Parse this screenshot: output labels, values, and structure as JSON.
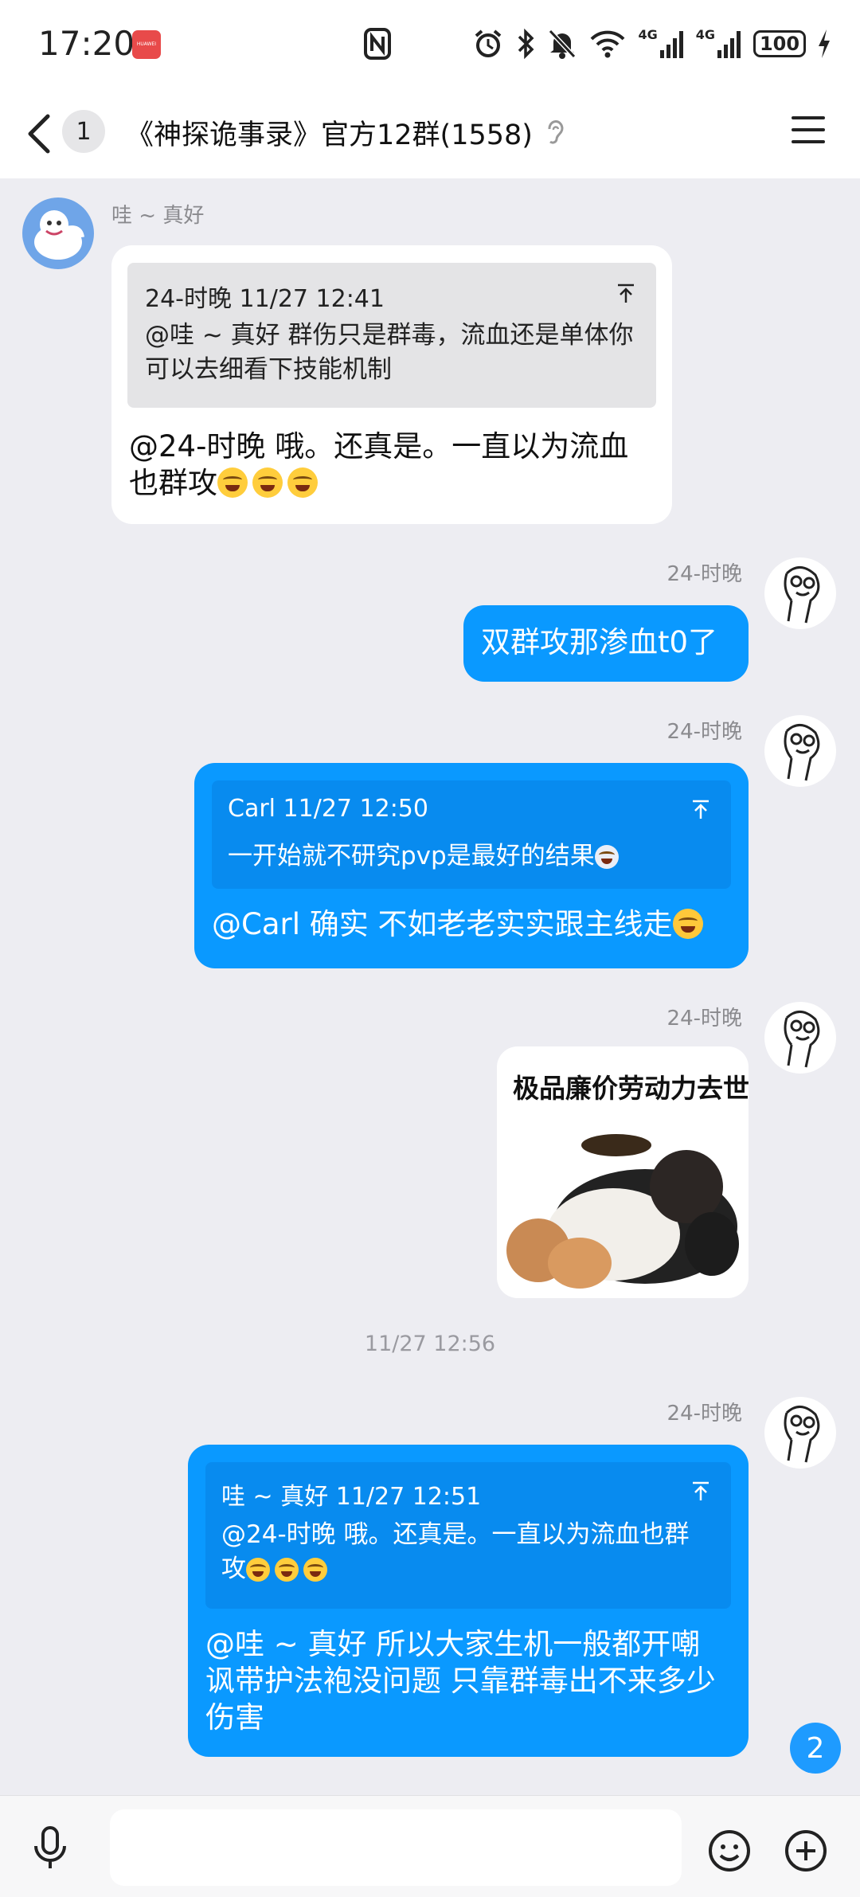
{
  "status": {
    "time": "17:20",
    "carrier_badge": "HUAWEI",
    "signal1": "4G",
    "signal2": "4G",
    "battery": "100"
  },
  "header": {
    "unread_count": "1",
    "title": "《神探诡事录》官方12群(1558)"
  },
  "messages": [
    {
      "sender": "哇 ~ 真好",
      "quote_head": "24-时晚 11/27 12:41",
      "quote_body": "@哇 ~ 真好 群伤只是群毒，流血还是单体你可以去细看下技能机制",
      "text": "@24-时晚 哦。还真是。一直以为流血也群攻"
    },
    {
      "sender": "24-时晚",
      "text": "双群攻那渗血t0了"
    },
    {
      "sender": "24-时晚",
      "quote_head": "Carl 11/27 12:50",
      "quote_body": "一开始就不研究pvp是最好的结果",
      "text": "@Carl 确实 不如老老实实跟主线走"
    },
    {
      "sender": "24-时晚",
      "sticker_caption": "极品廉价劳动力去世"
    },
    {
      "divider": "11/27 12:56"
    },
    {
      "sender": "24-时晚",
      "quote_head": "哇 ~ 真好 11/27 12:51",
      "quote_body": "@24-时晚 哦。还真是。一直以为流血也群攻",
      "text": "@哇 ~ 真好 所以大家生机一般都开嘲讽带护法袍没问题 只靠群毒出不来多少伤害"
    }
  ],
  "new_message_badge": "2",
  "input": {
    "placeholder": ""
  },
  "icons": [
    "back-arrow-icon",
    "ear-icon",
    "menu-icon",
    "jump-to-quote-icon",
    "mic-icon",
    "emoji-icon",
    "plus-icon"
  ],
  "colors": {
    "bubble_blue": "#0a99ff",
    "background": "#ededf2",
    "badge_blue": "#1e9bff"
  }
}
